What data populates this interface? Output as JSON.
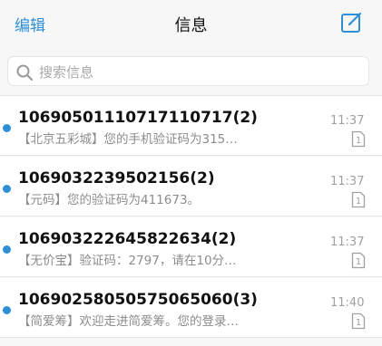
{
  "header": {
    "edit_label": "编辑",
    "title": "信息",
    "compose_icon": "compose-icon"
  },
  "search": {
    "placeholder": "搜索信息",
    "icon": "search-icon"
  },
  "messages": [
    {
      "sender": "10690501110717110717(2)",
      "preview": "【北京五彩城】您的手机验证码为315…",
      "time": "11:37",
      "sim": "1",
      "unread": true
    },
    {
      "sender": "1069032239502156(2)",
      "preview": "【元码】您的验证码为411673。",
      "time": "11:37",
      "sim": "1",
      "unread": true
    },
    {
      "sender": "106903222645822634(2)",
      "preview": "【无价宝】验证码：2797，请在10分…",
      "time": "11:37",
      "sim": "1",
      "unread": true
    },
    {
      "sender": "10690258050575065060(3)",
      "preview": "【简爱筹】欢迎走进简爱筹。您的登录…",
      "time": "11:40",
      "sim": "1",
      "unread": true
    }
  ],
  "colors": {
    "accent": "#2f8fd6",
    "background": "#f7f7f7",
    "secondary_text": "#8c8c8c"
  }
}
